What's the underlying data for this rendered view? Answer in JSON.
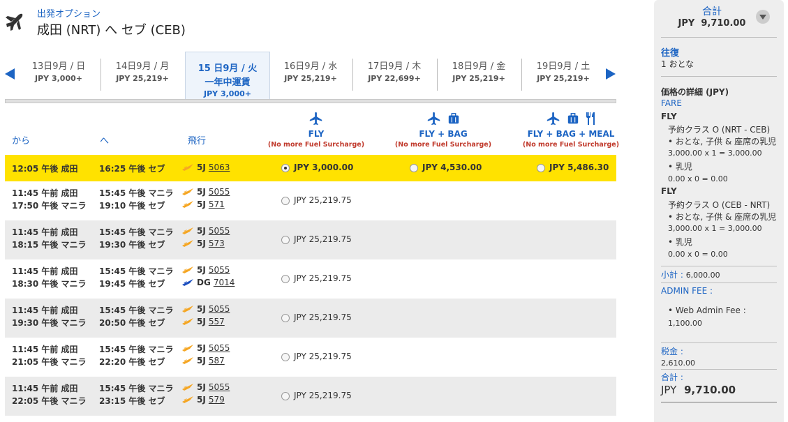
{
  "header": {
    "subtitle": "出発オプション",
    "title": "成田 (NRT) へ セブ (CEB)"
  },
  "dates": [
    {
      "date": "13日9月 / 日",
      "price": "JPY 3,000+"
    },
    {
      "date": "14日9月 / 月",
      "price": "JPY 25,219+"
    },
    {
      "date": "15 日9月 / 火",
      "fare": "一年中運賃",
      "price": "JPY 3,000+",
      "selected": true
    },
    {
      "date": "16日9月 / 水",
      "price": "JPY 25,219+"
    },
    {
      "date": "17日9月 / 木",
      "price": "JPY 22,699+"
    },
    {
      "date": "18日9月 / 金",
      "price": "JPY 25,219+"
    },
    {
      "date": "19日9月 / 土",
      "price": "JPY 25,219+"
    }
  ],
  "columns": {
    "from": "から",
    "to": "へ",
    "flight": "飛行",
    "fares": [
      {
        "name": "FLY",
        "note": "(No more Fuel Surcharge)"
      },
      {
        "name": "FLY + BAG",
        "note": "(No more Fuel Surcharge)"
      },
      {
        "name": "FLY + BAG + MEAL",
        "note": "(No more Fuel Surcharge)"
      }
    ]
  },
  "flights": [
    {
      "selected": true,
      "dep": [
        "12:05 午後 成田"
      ],
      "arr": [
        "16:25 午後 セブ"
      ],
      "flights": [
        {
          "code": "5J",
          "num": "5063",
          "airline": "cebu"
        }
      ],
      "prices": [
        "JPY 3,000.00",
        "JPY 4,530.00",
        "JPY 5,486.30"
      ]
    },
    {
      "dep": [
        "11:45 午前 成田",
        "17:50 午後 マニラ"
      ],
      "arr": [
        "15:45 午後 マニラ",
        "19:10 午後 セブ"
      ],
      "flights": [
        {
          "code": "5J",
          "num": "5055",
          "airline": "cebu"
        },
        {
          "code": "5J",
          "num": "571",
          "airline": "cebu"
        }
      ],
      "prices": [
        "JPY 25,219.75"
      ]
    },
    {
      "dep": [
        "11:45 午前 成田",
        "18:15 午後 マニラ"
      ],
      "arr": [
        "15:45 午後 マニラ",
        "19:30 午後 セブ"
      ],
      "flights": [
        {
          "code": "5J",
          "num": "5055",
          "airline": "cebu"
        },
        {
          "code": "5J",
          "num": "573",
          "airline": "cebu"
        }
      ],
      "prices": [
        "JPY 25,219.75"
      ]
    },
    {
      "dep": [
        "11:45 午前 成田",
        "18:30 午後 マニラ"
      ],
      "arr": [
        "15:45 午後 マニラ",
        "19:45 午後 セブ"
      ],
      "flights": [
        {
          "code": "5J",
          "num": "5055",
          "airline": "cebu"
        },
        {
          "code": "DG",
          "num": "7014",
          "airline": "cebgo"
        }
      ],
      "prices": [
        "JPY 25,219.75"
      ]
    },
    {
      "dep": [
        "11:45 午前 成田",
        "19:30 午後 マニラ"
      ],
      "arr": [
        "15:45 午後 マニラ",
        "20:50 午後 セブ"
      ],
      "flights": [
        {
          "code": "5J",
          "num": "5055",
          "airline": "cebu"
        },
        {
          "code": "5J",
          "num": "557",
          "airline": "cebu"
        }
      ],
      "prices": [
        "JPY 25,219.75"
      ]
    },
    {
      "dep": [
        "11:45 午前 成田",
        "21:05 午後 マニラ"
      ],
      "arr": [
        "15:45 午後 マニラ",
        "22:20 午後 セブ"
      ],
      "flights": [
        {
          "code": "5J",
          "num": "5055",
          "airline": "cebu"
        },
        {
          "code": "5J",
          "num": "587",
          "airline": "cebu"
        }
      ],
      "prices": [
        "JPY 25,219.75"
      ]
    },
    {
      "dep": [
        "11:45 午前 成田",
        "22:05 午後 マニラ"
      ],
      "arr": [
        "15:45 午後 マニラ",
        "23:15 午後 セブ"
      ],
      "flights": [
        {
          "code": "5J",
          "num": "5055",
          "airline": "cebu"
        },
        {
          "code": "5J",
          "num": "579",
          "airline": "cebu"
        }
      ],
      "prices": [
        "JPY 25,219.75"
      ]
    }
  ],
  "sidebar": {
    "total_label": "合計",
    "total_value": "JPY  9,710.00",
    "trip_type": "往復",
    "passengers": "1 おとな",
    "details_title": "価格の詳細 (JPY)",
    "fare_label": "FARE",
    "segments": [
      {
        "label": "FLY",
        "class": "予約クラス O (NRT - CEB)",
        "pax1": "• おとな, 子供 & 座席の乳児",
        "pax1_calc": "3,000.00 x 1 = 3,000.00",
        "pax2": "• 乳児",
        "pax2_calc": "0.00 x 0 = 0.00"
      },
      {
        "label": "FLY",
        "class": "予約クラス O (CEB - NRT)",
        "pax1": "• おとな, 子供 & 座席の乳児",
        "pax1_calc": "3,000.00 x 1 = 3,000.00",
        "pax2": "• 乳児",
        "pax2_calc": "0.00 x 0 = 0.00"
      }
    ],
    "subtotal_label": "小計 :",
    "subtotal_value": "6,000.00",
    "admin_label": "ADMIN FEE :",
    "admin_item": "• Web Admin Fee :",
    "admin_value": "1,100.00",
    "tax_label": "税金 :",
    "tax_value": "2,610.00",
    "grand_label": "合計 :",
    "grand_currency": "JPY",
    "grand_value": "9,710.00"
  },
  "colors": {
    "accent": "#1c64c3",
    "selected_row": "#ffe200",
    "surcharge_red": "#c0392b"
  }
}
